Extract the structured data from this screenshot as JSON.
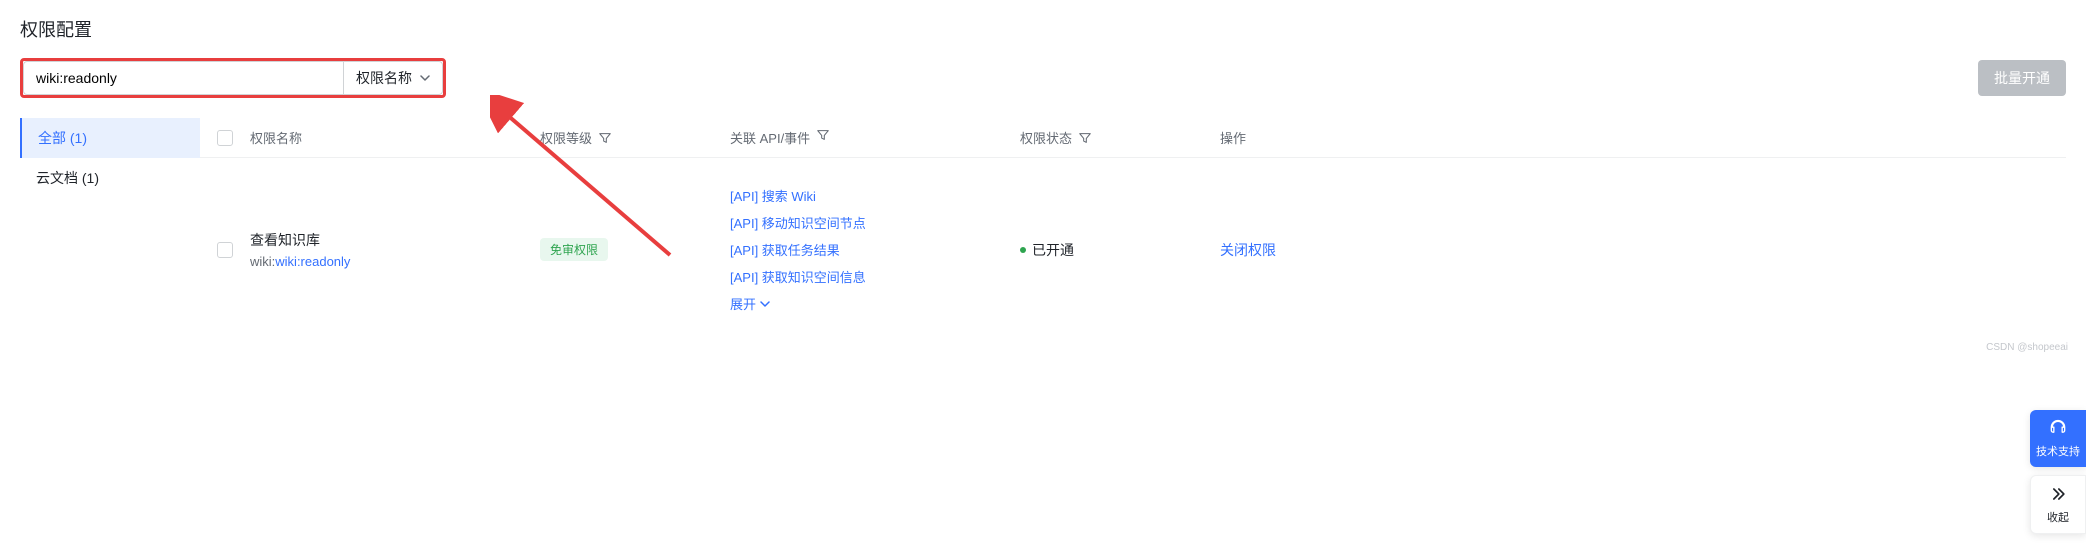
{
  "page": {
    "title": "权限配置"
  },
  "search": {
    "value": "wiki:readonly",
    "select_label": "权限名称"
  },
  "buttons": {
    "batch_open": "批量开通"
  },
  "sidebar": {
    "items": [
      {
        "label": "全部 (1)",
        "active": true
      },
      {
        "label": "云文档 (1)",
        "active": false
      }
    ]
  },
  "table": {
    "headers": {
      "name": "权限名称",
      "level": "权限等级",
      "api": "关联 API/事件",
      "status": "权限状态",
      "action": "操作"
    },
    "rows": [
      {
        "title": "查看知识库",
        "code_prefix": "wiki:",
        "code_highlight": "wiki:readonly",
        "level_badge": "免审权限",
        "apis": [
          "[API] 搜索 Wiki",
          "[API] 移动知识空间节点",
          "[API] 获取任务结果",
          "[API] 获取知识空间信息"
        ],
        "expand": "展开",
        "status": "已开通",
        "action": "关闭权限"
      }
    ]
  },
  "float": {
    "support": "技术支持",
    "collapse": "收起"
  },
  "watermark": "CSDN @shopeeai"
}
